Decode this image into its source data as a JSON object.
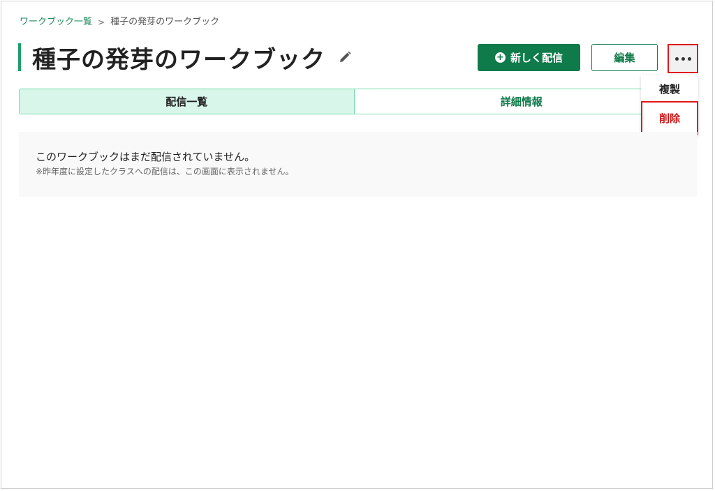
{
  "breadcrumb": {
    "parent": "ワークブック一覧",
    "separator": ">",
    "current": "種子の発芽のワークブック"
  },
  "header": {
    "title": "種子の発芽のワークブック",
    "edit_icon": "pencil-icon",
    "new_delivery_label": "新しく配信",
    "new_delivery_icon": "plus-circle-icon",
    "edit_label": "編集",
    "more_icon": "ellipsis-icon"
  },
  "tabs": [
    {
      "label": "配信一覧",
      "active": true
    },
    {
      "label": "詳細情報",
      "active": false
    }
  ],
  "menu": {
    "items": [
      {
        "label": "複製"
      },
      {
        "label": "削除"
      }
    ]
  },
  "empty_state": {
    "message": "このワークブックはまだ配信されていません。",
    "note": "※昨年度に設定したクラスへの配信は、この画面に表示されません。"
  },
  "colors": {
    "accent_green": "#0f7a4a",
    "tab_border": "#78d9ae",
    "tab_active_bg": "#d8f6ea",
    "highlight_red": "#e01818",
    "delete_red": "#d01515"
  }
}
